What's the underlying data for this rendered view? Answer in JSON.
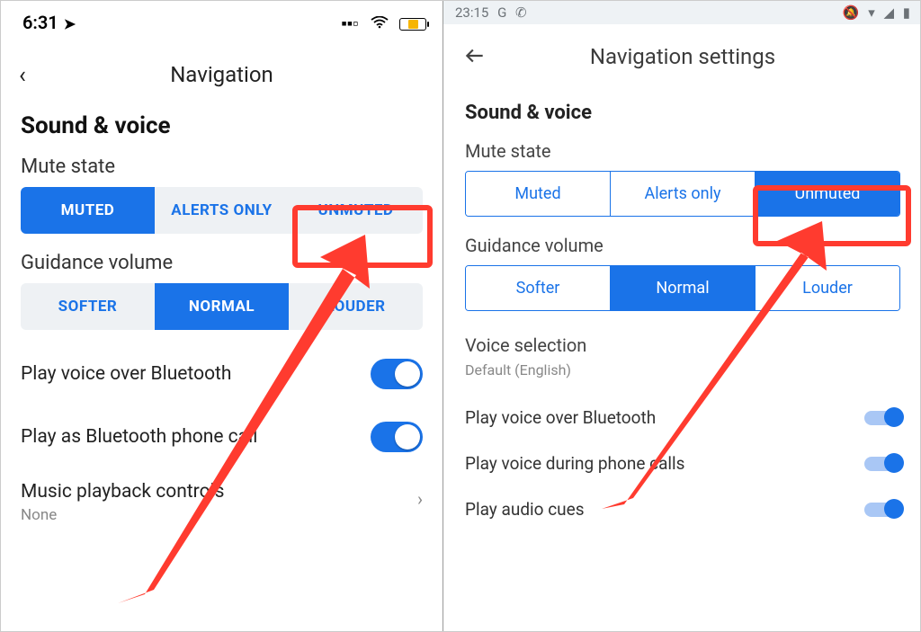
{
  "left": {
    "status": {
      "time": "6:31",
      "location_icon": "➤",
      "signal": "▪▪",
      "wifi": "wifi-icon",
      "battery_pct": 40
    },
    "header": {
      "back": "‹",
      "title": "Navigation"
    },
    "section": "Sound & voice",
    "mute": {
      "label": "Mute state",
      "options": [
        "MUTED",
        "ALERTS ONLY",
        "UNMUTED"
      ],
      "active": 0
    },
    "guidance": {
      "label": "Guidance volume",
      "options": [
        "SOFTER",
        "NORMAL",
        "LOUDER"
      ],
      "active": 1
    },
    "toggles": [
      {
        "label": "Play voice over Bluetooth",
        "on": true
      },
      {
        "label": "Play as Bluetooth phone call",
        "on": true
      }
    ],
    "music": {
      "label": "Music playback controls",
      "sub": "None"
    }
  },
  "right": {
    "status": {
      "time": "23:15",
      "left_icons": [
        "G",
        "✆"
      ],
      "right_icons": [
        "🔕",
        "▾",
        "◢",
        "▮"
      ]
    },
    "header": {
      "title": "Navigation settings"
    },
    "section": "Sound & voice",
    "mute": {
      "label": "Mute state",
      "options": [
        "Muted",
        "Alerts only",
        "Unmuted"
      ],
      "active": 2
    },
    "guidance": {
      "label": "Guidance volume",
      "options": [
        "Softer",
        "Normal",
        "Louder"
      ],
      "active": 1
    },
    "voice": {
      "label": "Voice selection",
      "sub": "Default (English)"
    },
    "toggles": [
      {
        "label": "Play voice over Bluetooth",
        "on": true
      },
      {
        "label": "Play voice during phone calls",
        "on": true
      },
      {
        "label": "Play audio cues",
        "on": true
      }
    ]
  },
  "annotation": {
    "highlight": "Unmuted option",
    "color": "#ff3b2f"
  }
}
